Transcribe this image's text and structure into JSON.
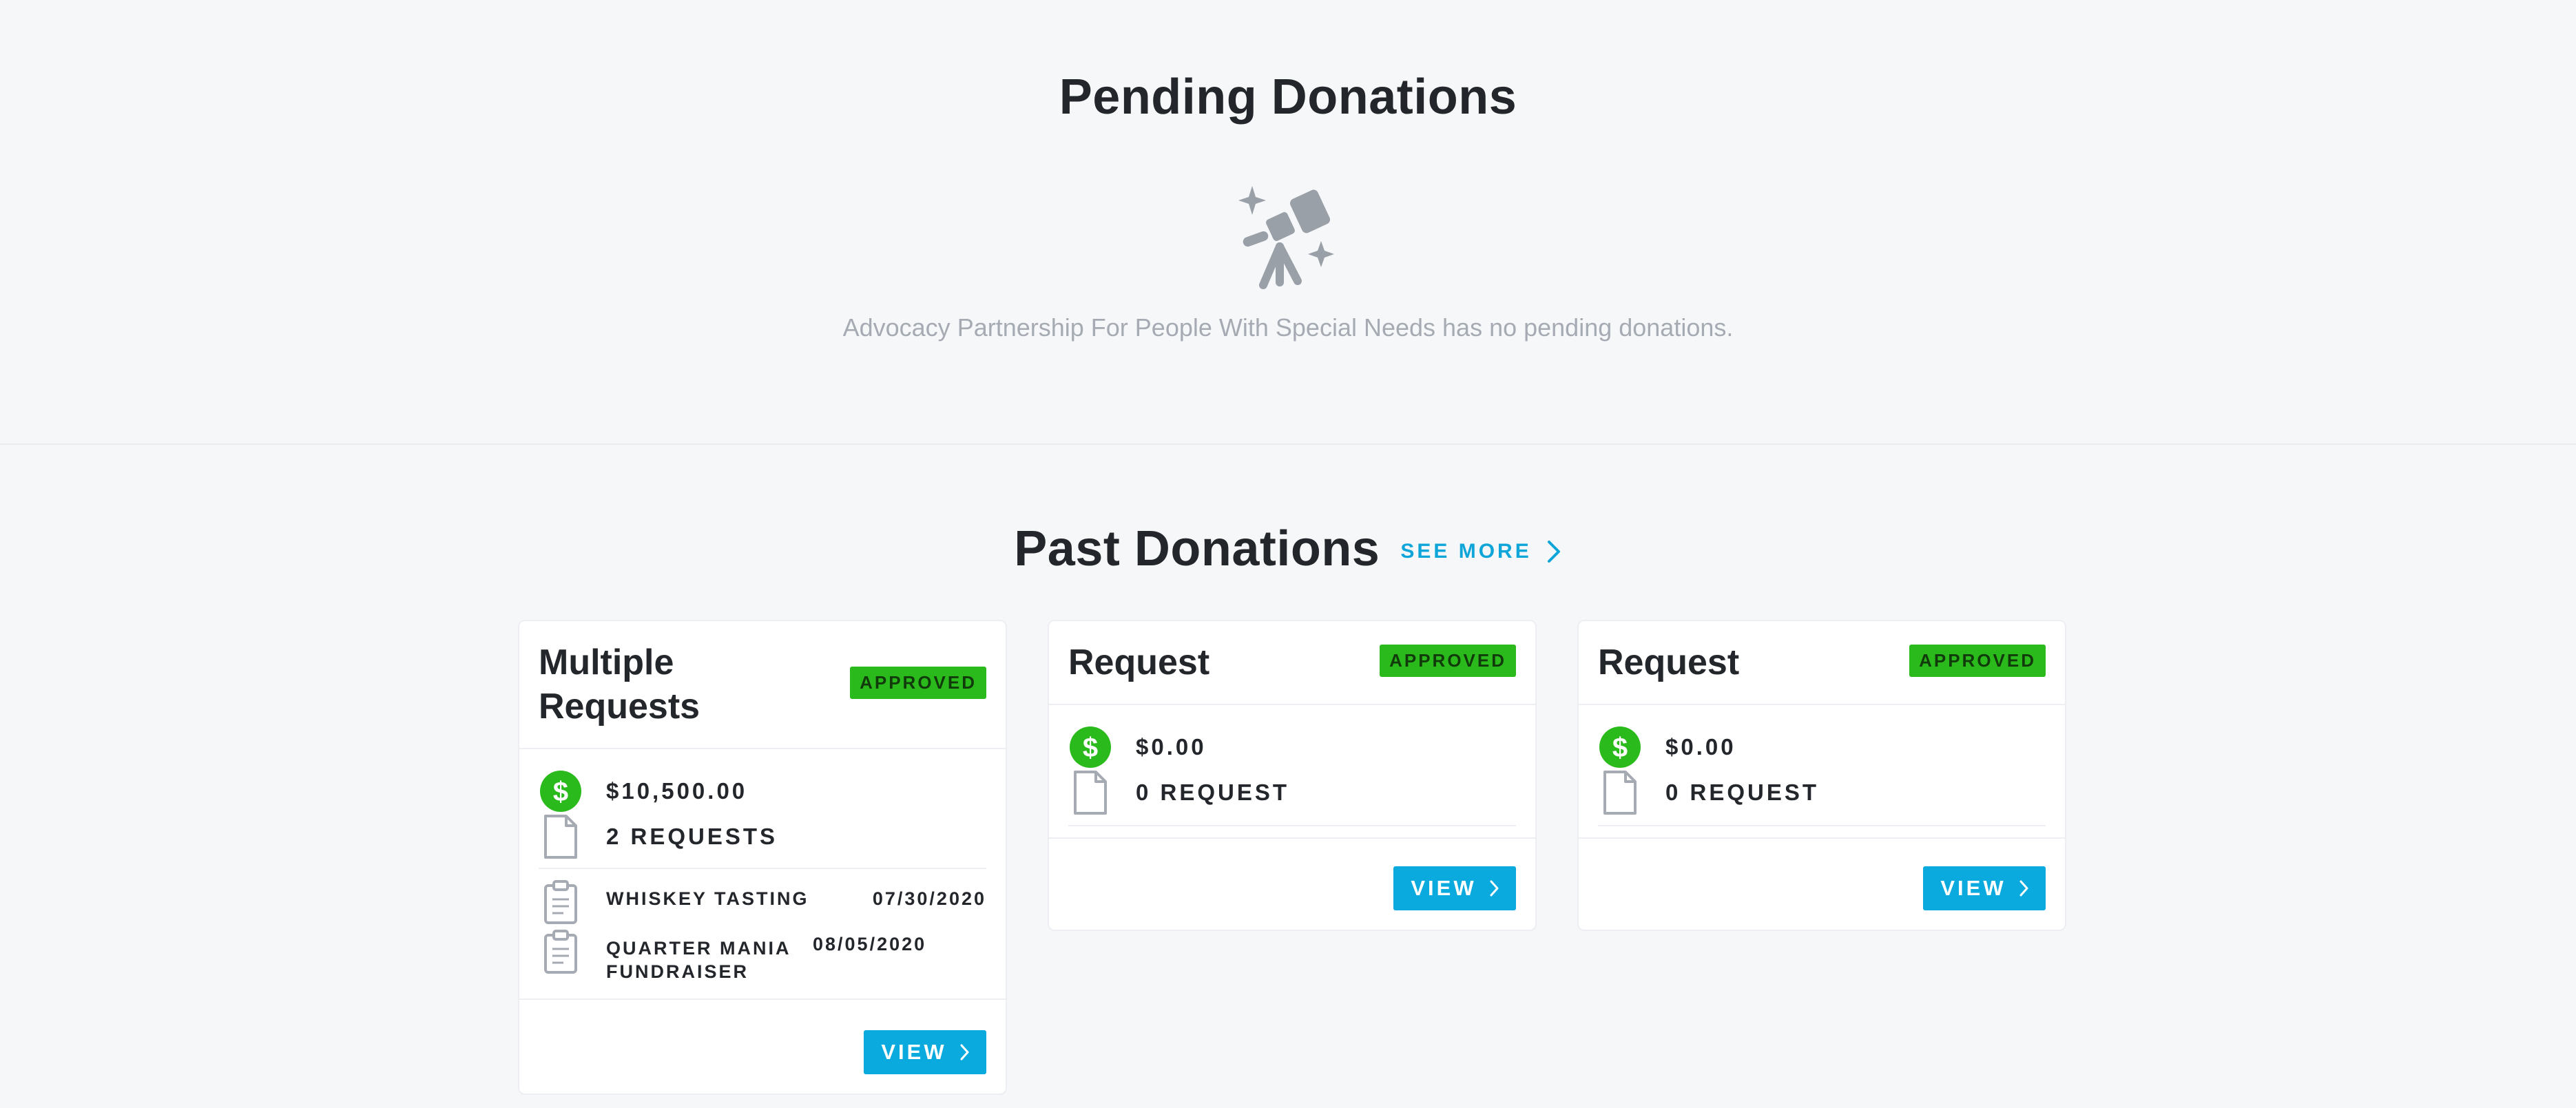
{
  "pending": {
    "title": "Pending Donations",
    "empty_message": "Advocacy Partnership For People With Special Needs has no pending donations.",
    "empty_icon": "telescope-icon"
  },
  "past": {
    "title": "Past Donations",
    "see_more_label": "SEE MORE",
    "cards": [
      {
        "title": "Multiple Requests",
        "status": "APPROVED",
        "amount": "$10,500.00",
        "requests": "2 REQUESTS",
        "events": [
          {
            "name": "WHISKEY TASTING",
            "date": "07/30/2020"
          },
          {
            "name": "QUARTER MANIA FUNDRAISER",
            "date": "08/05/2020"
          }
        ],
        "view_label": "VIEW"
      },
      {
        "title": "Request",
        "status": "APPROVED",
        "amount": "$0.00",
        "requests": "0 REQUEST",
        "view_label": "VIEW"
      },
      {
        "title": "Request",
        "status": "APPROVED",
        "amount": "$0.00",
        "requests": "0 REQUEST",
        "view_label": "VIEW"
      }
    ]
  },
  "colors": {
    "accent": "#0aa9de",
    "approved": "#2bba1c",
    "background": "#f6f7f9"
  }
}
